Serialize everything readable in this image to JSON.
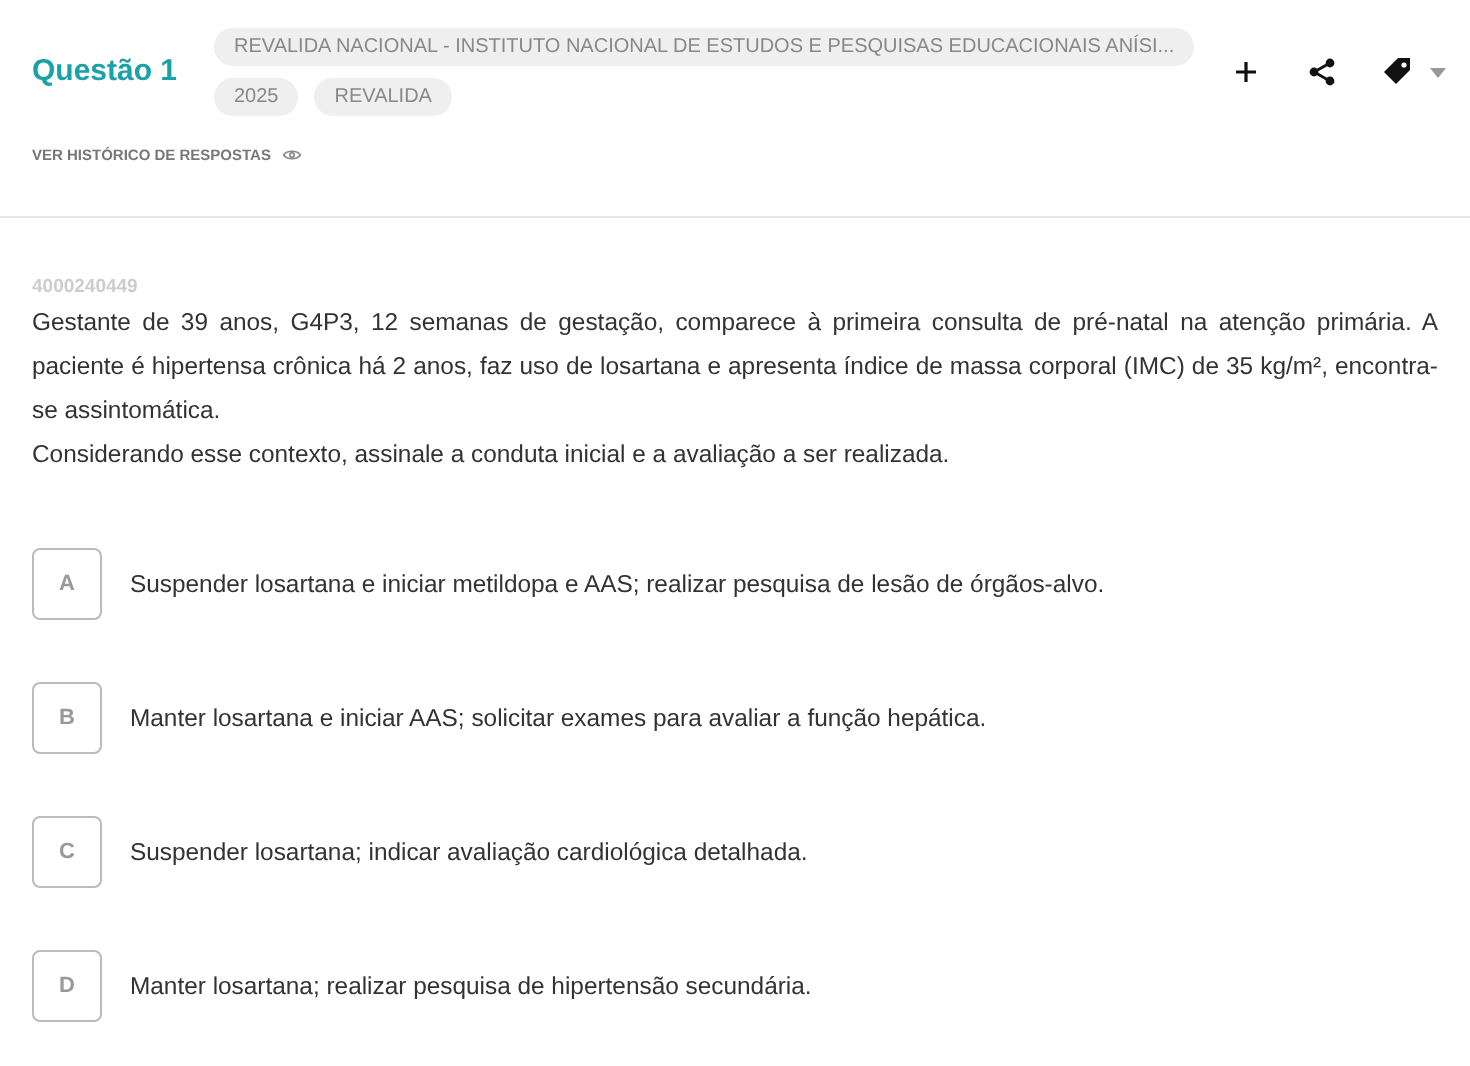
{
  "header": {
    "title": "Questão 1",
    "source_tags": [
      "REVALIDA NACIONAL - INSTITUTO NACIONAL DE ESTUDOS E PESQUISAS EDUCACIONAIS ANÍSI..."
    ],
    "tags": [
      "2025",
      "REVALIDA"
    ],
    "history_link": "VER HISTÓRICO DE RESPOSTAS"
  },
  "question": {
    "id": "4000240449",
    "paragraphs": [
      "Gestante de 39 anos, G4P3, 12 semanas de gestação, comparece à primeira consulta de pré-natal na atenção primária. A paciente é hipertensa crônica há 2 anos, faz uso de losartana e apresenta índice de massa corporal (IMC) de 35 kg/m², encontra-se assintomática.",
      "Considerando esse contexto, assinale a conduta inicial e a avaliação a ser realizada."
    ]
  },
  "alternatives": [
    {
      "letter": "A",
      "text": "Suspender losartana e iniciar metildopa e AAS; realizar pesquisa de lesão de órgãos-alvo.",
      "selected": false
    },
    {
      "letter": "B",
      "text": "Manter losartana e iniciar AAS; solicitar exames para avaliar a função hepática.",
      "selected": false
    },
    {
      "letter": "C",
      "text": "Suspender losartana; indicar avaliação cardiológica detalhada.",
      "selected": false
    },
    {
      "letter": "D",
      "text": "Manter losartana; realizar pesquisa de hipertensão secundária.",
      "selected": false
    }
  ]
}
